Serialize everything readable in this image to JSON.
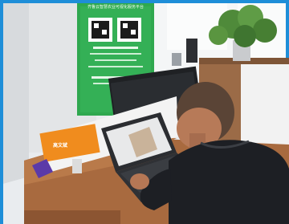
{
  "scene": {
    "poster_heading": "齐鲁云智慧农业可视化服务平台",
    "poster_line_1": "手机扫码 免费体验",
    "poster_line_2": "全网营销 搜索曝光打开",
    "sign_text": "高文斌"
  },
  "colors": {
    "border": "#1e8ed8",
    "poster_green": "#2fa84f",
    "desk_wood": "#a86a3f",
    "shirt": "#1d1f24",
    "laptop": "#2b2d31"
  }
}
